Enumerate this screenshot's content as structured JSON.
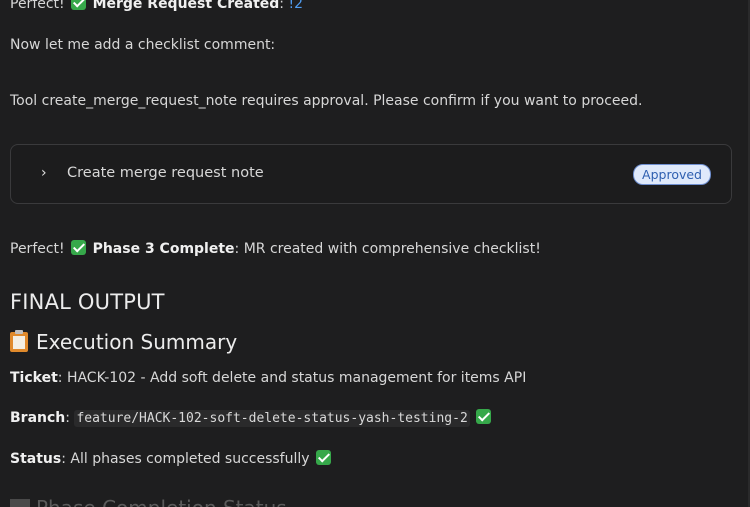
{
  "messages": {
    "mr_created": {
      "prefix": "Perfect!",
      "bold": "Merge Request Created",
      "sep": ":",
      "link": "!2"
    },
    "add_checklist": "Now let me add a checklist comment:",
    "approval_notice": "Tool create_merge_request_note requires approval. Please confirm if you want to proceed.",
    "tool_card": {
      "title": "Create merge request note",
      "status": "Approved"
    },
    "phase_complete": {
      "prefix": "Perfect!",
      "bold": "Phase 3 Complete",
      "rest": ": MR created with comprehensive checklist!"
    }
  },
  "final_output": {
    "heading": "FINAL OUTPUT",
    "summary_heading": "Execution Summary",
    "ticket": {
      "label": "Ticket",
      "value": ": HACK-102 - Add soft delete and status management for items API"
    },
    "branch": {
      "label": "Branch",
      "sep": ":",
      "value": "feature/HACK-102-soft-delete-status-yash-testing-2"
    },
    "status": {
      "label": "Status",
      "value": ": All phases completed successfully"
    },
    "next_heading_partial": "Phase Completion Status"
  },
  "icons": {
    "check": "check-mark-icon",
    "clipboard": "clipboard-icon",
    "chevron": "chevron-right-icon",
    "chart": "bar-chart-icon"
  },
  "colors": {
    "background": "#1e1e1f",
    "link": "#4f9cf0",
    "check": "#36a84a",
    "badge_bg": "#dfe9fb",
    "badge_text": "#2f5fb0"
  }
}
